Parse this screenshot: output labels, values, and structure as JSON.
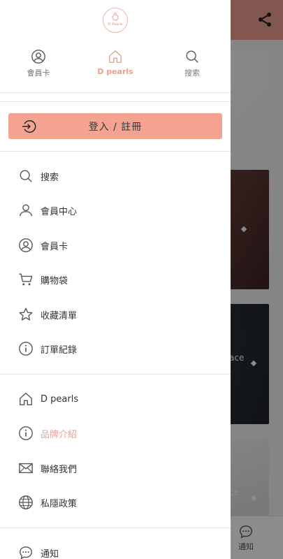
{
  "drawer": {
    "logo_text": "D Pearls",
    "tabs": [
      {
        "label": "會員卡",
        "icon": "user-circle-icon"
      },
      {
        "label": "D pearls",
        "icon": "home-icon",
        "active": true
      },
      {
        "label": "搜索",
        "icon": "search-icon"
      }
    ],
    "login_label": "登入 / 註冊",
    "menu_group_1": [
      {
        "label": "搜索",
        "icon": "search-icon"
      },
      {
        "label": "會員中心",
        "icon": "user-icon"
      },
      {
        "label": "會員卡",
        "icon": "user-circle-icon"
      },
      {
        "label": "購物袋",
        "icon": "cart-icon"
      },
      {
        "label": "收藏清單",
        "icon": "star-icon"
      },
      {
        "label": "訂單紀錄",
        "icon": "info-icon"
      }
    ],
    "menu_group_2": [
      {
        "label": "D pearls",
        "icon": "home-icon"
      },
      {
        "label": "品牌介紹",
        "icon": "info-icon",
        "highlight": true
      },
      {
        "label": "聯絡我們",
        "icon": "mail-icon"
      },
      {
        "label": "私隱政策",
        "icon": "globe-icon"
      }
    ],
    "menu_group_3": [
      {
        "label": "通知",
        "icon": "chat-icon"
      }
    ]
  },
  "background": {
    "card_3_text": "ace",
    "card_4_text": "ce",
    "notify_label": "通知"
  },
  "colors": {
    "accent": "#f5a391",
    "accent_text": "#e9a08f",
    "topbar": "#ef9f94"
  }
}
